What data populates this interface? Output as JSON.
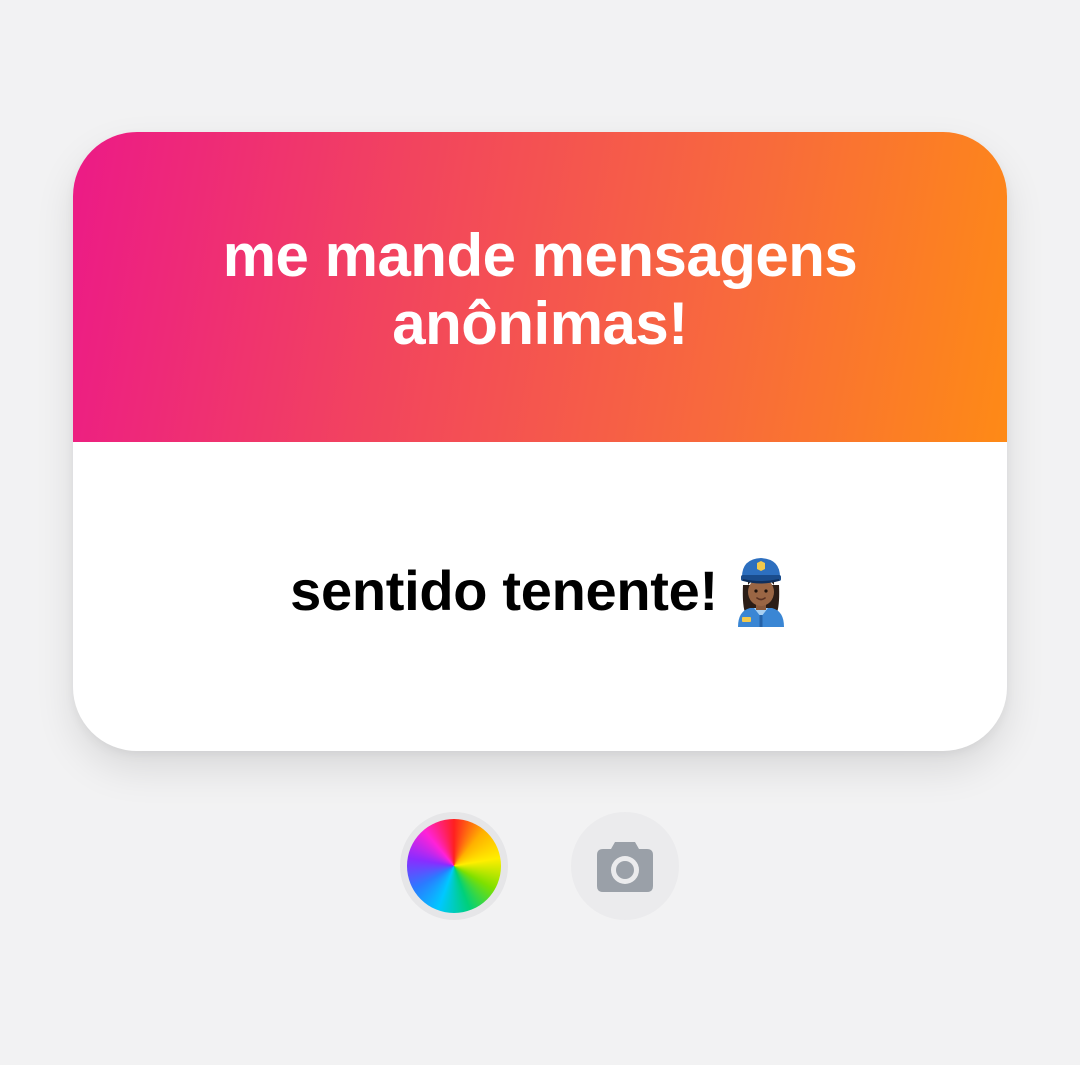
{
  "card": {
    "title": "me mande mensagens anônimas!",
    "reply": "sentido tenente!",
    "reply_emoji": "police-officer-woman-icon"
  },
  "controls": {
    "color_button": "color-wheel-icon",
    "camera_button": "camera-icon"
  },
  "colors": {
    "gradient_start": "#ec1a87",
    "gradient_end": "#fe8a16",
    "background": "#f2f2f3",
    "camera_icon": "#9aa0a8"
  }
}
